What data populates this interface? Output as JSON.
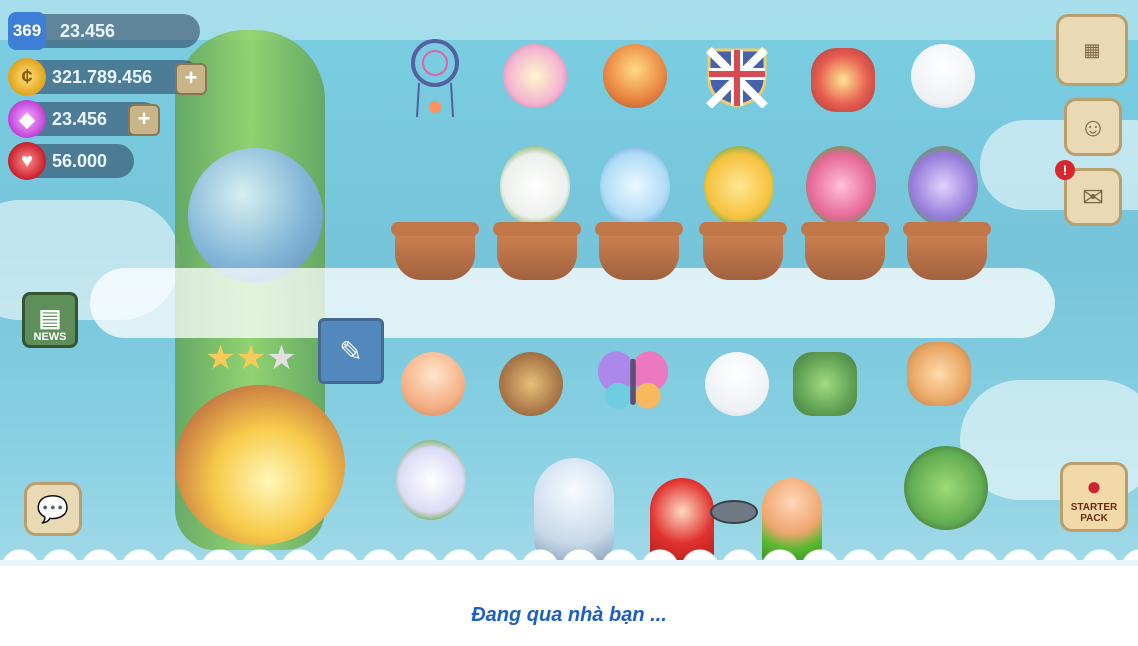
{
  "player": {
    "level": "369",
    "xp": "23.456"
  },
  "resources": {
    "coins": "321.789.456",
    "gems": "23.456",
    "hearts": "56.000"
  },
  "buttons": {
    "news_label": "NEWS",
    "starter_pack_label": "STARTER PACK",
    "plus_label": "+",
    "notification_badge": "!"
  },
  "loading": {
    "text": "Đang qua nhà bạn ..."
  },
  "colors": {
    "sky": "#5ec4dc",
    "accent_text": "#1f5fbf",
    "pot": "#b55a22",
    "alert": "#d8262e"
  },
  "icons": {
    "level": "star-badge-icon",
    "coins": "coin-icon",
    "gems": "diamond-icon",
    "hearts": "heart-icon",
    "grid_menu": "grid-menu-icon",
    "friends": "face-icon",
    "mail": "envelope-icon",
    "chat": "chat-bubble-icon"
  }
}
